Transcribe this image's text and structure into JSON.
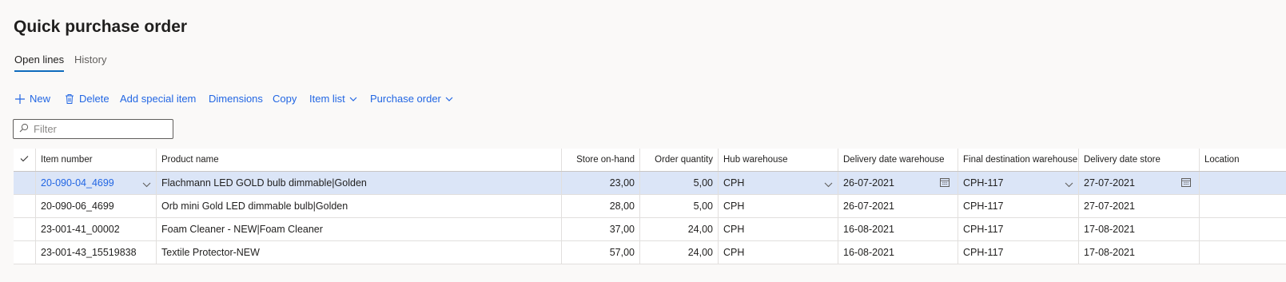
{
  "page": {
    "title": "Quick purchase order"
  },
  "tabs": [
    {
      "label": "Open lines",
      "active": true
    },
    {
      "label": "History",
      "active": false
    }
  ],
  "toolbar": {
    "new_label": "New",
    "delete_label": "Delete",
    "add_special_item_label": "Add special item",
    "dimensions_label": "Dimensions",
    "copy_label": "Copy",
    "item_list_label": "Item list",
    "purchase_order_label": "Purchase order"
  },
  "filter": {
    "placeholder": "Filter",
    "value": ""
  },
  "grid": {
    "columns": {
      "item_number": "Item number",
      "product_name": "Product name",
      "store_on_hand": "Store on-hand",
      "order_quantity": "Order quantity",
      "hub_warehouse": "Hub warehouse",
      "delivery_date_warehouse": "Delivery date warehouse",
      "final_destination_warehouse": "Final destination warehouse",
      "delivery_date_store": "Delivery date store",
      "location": "Location"
    },
    "rows": [
      {
        "item_number": "20-090-04_4699",
        "product_name": "Flachmann LED GOLD bulb dimmable|Golden",
        "store_on_hand": "23,00",
        "order_quantity": "5,00",
        "hub_warehouse": "CPH",
        "delivery_date_warehouse": "26-07-2021",
        "final_destination_warehouse": "CPH-117",
        "delivery_date_store": "27-07-2021",
        "location": ""
      },
      {
        "item_number": "20-090-06_4699",
        "product_name": "Orb mini Gold LED dimmable bulb|Golden",
        "store_on_hand": "28,00",
        "order_quantity": "5,00",
        "hub_warehouse": "CPH",
        "delivery_date_warehouse": "26-07-2021",
        "final_destination_warehouse": "CPH-117",
        "delivery_date_store": "27-07-2021",
        "location": ""
      },
      {
        "item_number": "23-001-41_00002",
        "product_name": "Foam Cleaner - NEW|Foam Cleaner",
        "store_on_hand": "37,00",
        "order_quantity": "24,00",
        "hub_warehouse": "CPH",
        "delivery_date_warehouse": "16-08-2021",
        "final_destination_warehouse": "CPH-117",
        "delivery_date_store": "17-08-2021",
        "location": ""
      },
      {
        "item_number": "23-001-43_15519838",
        "product_name": "Textile Protector-NEW",
        "store_on_hand": "57,00",
        "order_quantity": "24,00",
        "hub_warehouse": "CPH",
        "delivery_date_warehouse": "16-08-2021",
        "final_destination_warehouse": "CPH-117",
        "delivery_date_store": "17-08-2021",
        "location": ""
      }
    ],
    "selected_row": 0
  },
  "icons": {
    "new": "plus-icon",
    "delete": "trash-icon",
    "dropdown": "chevron-down-icon",
    "filter": "search-icon",
    "select_all": "checkmark-icon",
    "date": "calendar-icon"
  },
  "colors": {
    "accent": "#2266e3",
    "selected_row": "#dbe5f7",
    "background": "#faf9f8"
  }
}
